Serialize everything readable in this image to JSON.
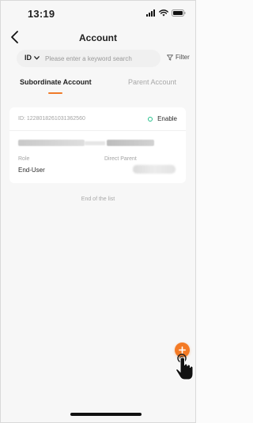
{
  "status_bar": {
    "time": "13:19",
    "signal_icon": "signal-icon",
    "wifi_icon": "wifi-icon",
    "battery_icon": "battery-icon"
  },
  "nav": {
    "back_icon": "chevron-left-icon",
    "title": "Account"
  },
  "search": {
    "type_label": "ID",
    "type_icon": "chevron-down-icon",
    "placeholder": "Please enter a keyword search",
    "value": "",
    "filter_icon": "filter-icon",
    "filter_label": "Filter"
  },
  "tabs": {
    "active": "Subordinate Account",
    "items": [
      {
        "label": "Subordinate Account"
      },
      {
        "label": "Parent Account"
      }
    ]
  },
  "accounts": [
    {
      "id_text": "ID: 1228018261031362560",
      "status": "Enable",
      "role_label": "Role",
      "role_value": "End-User",
      "parent_label": "Direct Parent"
    }
  ],
  "list_footer": "End of the list",
  "fab": {
    "icon": "plus-icon"
  },
  "colors": {
    "accent": "#f47a25",
    "status_enabled": "#22c18a",
    "background": "#f7f7f7",
    "card": "#ffffff"
  }
}
